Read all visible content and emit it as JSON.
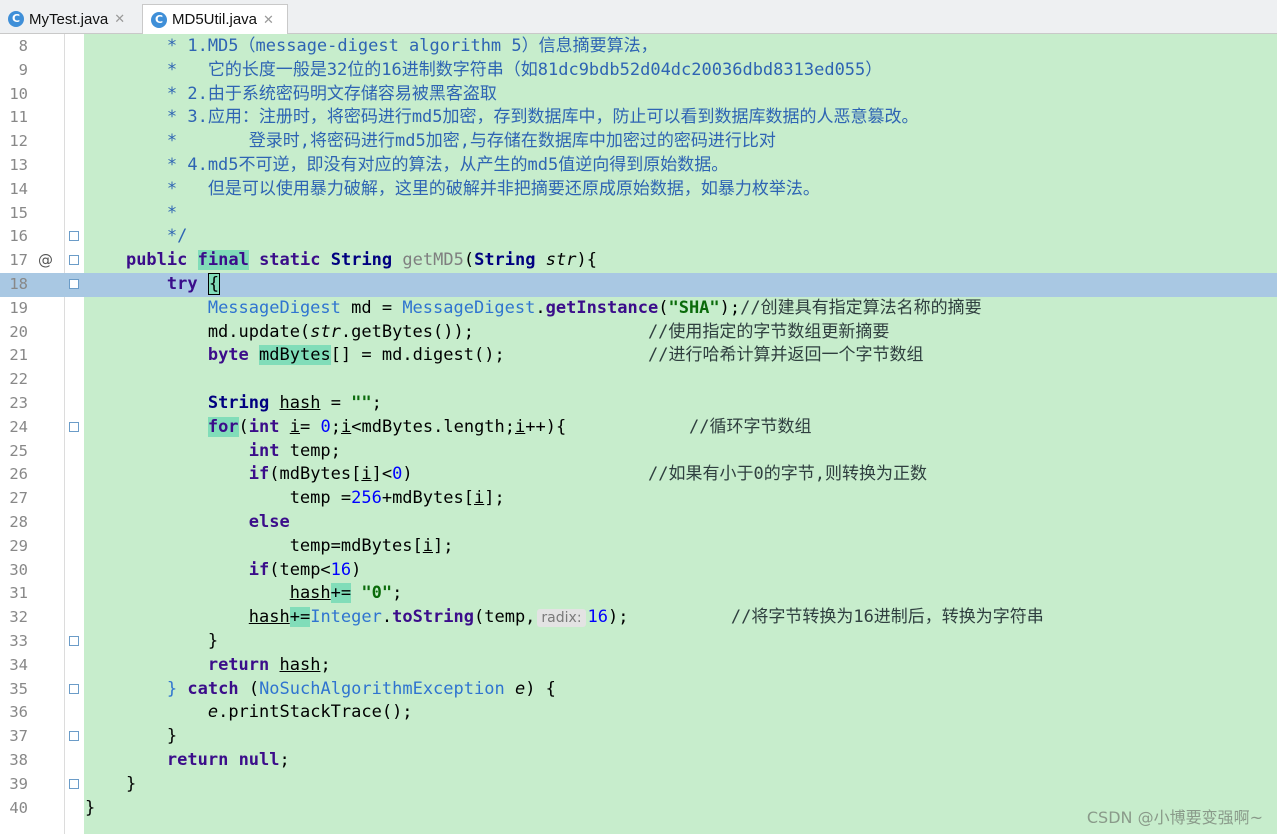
{
  "tabs": [
    {
      "label": "MyTest.java",
      "icon": "java-class-icon",
      "active": false
    },
    {
      "label": "MD5Util.java",
      "icon": "java-class-icon",
      "active": true
    }
  ],
  "current_line": 18,
  "lines": [
    {
      "n": "8",
      "segs": [
        [
          "        * 1.MD5（message-digest algorithm 5）信息摘要算法，",
          "cm"
        ]
      ]
    },
    {
      "n": "9",
      "segs": [
        [
          "        *   它的长度一般是32位的16进制数字符串（如81dc9bdb52d04dc20036dbd8313ed055）",
          "cm"
        ]
      ]
    },
    {
      "n": "10",
      "segs": [
        [
          "        * 2.由于系统密码明文存储容易被黑客盗取",
          "cm"
        ]
      ]
    },
    {
      "n": "11",
      "segs": [
        [
          "        * 3.应用：注册时，将密码进行md5加密，存到数据库中，防止可以看到数据库数据的人恶意篡改。",
          "cm"
        ]
      ]
    },
    {
      "n": "12",
      "segs": [
        [
          "        *       登录时,将密码进行md5加密,与存储在数据库中加密过的密码进行比对",
          "cm"
        ]
      ]
    },
    {
      "n": "13",
      "segs": [
        [
          "        * 4.md5不可逆，即没有对应的算法，从产生的md5值逆向得到原始数据。",
          "cm"
        ]
      ]
    },
    {
      "n": "14",
      "segs": [
        [
          "        *   但是可以使用暴力破解，这里的破解并非把摘要还原成原始数据，如暴力枚举法。",
          "cm"
        ]
      ]
    },
    {
      "n": "15",
      "segs": [
        [
          "        *",
          "cm"
        ]
      ]
    },
    {
      "n": "16",
      "fold": true,
      "segs": [
        [
          "        */",
          "cm"
        ]
      ]
    },
    {
      "n": "17",
      "mark": "@",
      "fold": true,
      "segs": [
        [
          "    ",
          ""
        ],
        [
          "public",
          "kw"
        ],
        [
          " ",
          ""
        ],
        [
          "final",
          "kw hl"
        ],
        [
          " ",
          ""
        ],
        [
          "static",
          "kw"
        ],
        [
          " ",
          ""
        ],
        [
          "String",
          "ty"
        ],
        [
          " ",
          ""
        ],
        [
          "getMD5",
          "gray"
        ],
        [
          "(",
          ""
        ],
        [
          "String",
          "ty"
        ],
        [
          " ",
          ""
        ],
        [
          "str",
          "it"
        ],
        [
          "){",
          ""
        ]
      ]
    },
    {
      "n": "18",
      "fold": true,
      "segs": [
        [
          "        ",
          ""
        ],
        [
          "try",
          "kw"
        ],
        [
          " ",
          ""
        ],
        [
          "{",
          "hl caret-box"
        ]
      ]
    },
    {
      "n": "19",
      "segs": [
        [
          "            ",
          ""
        ],
        [
          "MessageDigest",
          "cls"
        ],
        [
          " md = ",
          ""
        ],
        [
          "MessageDigest",
          "cls"
        ],
        [
          ".",
          ""
        ],
        [
          "getInstance",
          "kw"
        ],
        [
          "(",
          ""
        ],
        [
          "\"SHA\"",
          "str"
        ],
        [
          ");",
          ""
        ],
        [
          "//创建具有指定算法名称的摘要",
          "lc"
        ]
      ]
    },
    {
      "n": "20",
      "segs": [
        [
          "            md.update(",
          ""
        ],
        [
          "str",
          "it"
        ],
        [
          ".getBytes());                 ",
          ""
        ],
        [
          "//使用指定的字节数组更新摘要",
          "lc"
        ]
      ]
    },
    {
      "n": "21",
      "segs": [
        [
          "            ",
          ""
        ],
        [
          "byte",
          "kw"
        ],
        [
          " ",
          ""
        ],
        [
          "mdBytes",
          "hl"
        ],
        [
          "[] = md.digest();              ",
          ""
        ],
        [
          "//进行哈希计算并返回一个字节数组",
          "lc"
        ]
      ]
    },
    {
      "n": "22",
      "segs": [
        [
          "",
          ""
        ]
      ]
    },
    {
      "n": "23",
      "segs": [
        [
          "            ",
          ""
        ],
        [
          "String",
          "ty"
        ],
        [
          " ",
          ""
        ],
        [
          "hash",
          "ul"
        ],
        [
          " = ",
          ""
        ],
        [
          "\"\"",
          "str"
        ],
        [
          ";",
          ""
        ]
      ]
    },
    {
      "n": "24",
      "fold": true,
      "segs": [
        [
          "            ",
          ""
        ],
        [
          "for",
          "kw hl"
        ],
        [
          "(",
          ""
        ],
        [
          "int",
          "kw"
        ],
        [
          " ",
          ""
        ],
        [
          "i",
          "ul"
        ],
        [
          "= ",
          ""
        ],
        [
          "0",
          "num"
        ],
        [
          ";",
          ""
        ],
        [
          "i",
          "ul"
        ],
        [
          "<mdBytes.length;",
          ""
        ],
        [
          "i",
          "ul"
        ],
        [
          "++){            ",
          ""
        ],
        [
          "//循环字节数组",
          "lc"
        ]
      ]
    },
    {
      "n": "25",
      "segs": [
        [
          "                ",
          ""
        ],
        [
          "int",
          "kw"
        ],
        [
          " temp;",
          ""
        ]
      ]
    },
    {
      "n": "26",
      "segs": [
        [
          "                ",
          ""
        ],
        [
          "if",
          "kw"
        ],
        [
          "(mdBytes[",
          ""
        ],
        [
          "i",
          "ul"
        ],
        [
          "]<",
          ""
        ],
        [
          "0",
          "num"
        ],
        [
          ")                       ",
          ""
        ],
        [
          "//如果有小于0的字节,则转换为正数",
          "lc"
        ]
      ]
    },
    {
      "n": "27",
      "segs": [
        [
          "                    temp =",
          ""
        ],
        [
          "256",
          "num"
        ],
        [
          "+mdBytes[",
          ""
        ],
        [
          "i",
          "ul"
        ],
        [
          "];",
          ""
        ]
      ]
    },
    {
      "n": "28",
      "segs": [
        [
          "                ",
          ""
        ],
        [
          "else",
          "kw"
        ]
      ]
    },
    {
      "n": "29",
      "segs": [
        [
          "                    temp=mdBytes[",
          ""
        ],
        [
          "i",
          "ul"
        ],
        [
          "];",
          ""
        ]
      ]
    },
    {
      "n": "30",
      "segs": [
        [
          "                ",
          ""
        ],
        [
          "if",
          "kw"
        ],
        [
          "(temp<",
          ""
        ],
        [
          "16",
          "num"
        ],
        [
          ")",
          ""
        ]
      ]
    },
    {
      "n": "31",
      "segs": [
        [
          "                    ",
          ""
        ],
        [
          "hash",
          "ul"
        ],
        [
          "+=",
          "hl"
        ],
        [
          " ",
          ""
        ],
        [
          "\"0\"",
          "str"
        ],
        [
          ";",
          ""
        ]
      ]
    },
    {
      "n": "32",
      "segs": [
        [
          "                ",
          ""
        ],
        [
          "hash",
          "ul"
        ],
        [
          "+=",
          "hl"
        ],
        [
          "Integer",
          "cls"
        ],
        [
          ".",
          ""
        ],
        [
          "toString",
          "kw"
        ],
        [
          "(temp,",
          ""
        ],
        [
          "radix:",
          "hint"
        ],
        [
          "16",
          "num"
        ],
        [
          ");          ",
          ""
        ],
        [
          "//将字节转换为16进制后，转换为字符串",
          "lc"
        ]
      ]
    },
    {
      "n": "33",
      "fold": true,
      "segs": [
        [
          "            }",
          ""
        ]
      ]
    },
    {
      "n": "34",
      "segs": [
        [
          "            ",
          ""
        ],
        [
          "return",
          "kw"
        ],
        [
          " ",
          ""
        ],
        [
          "hash",
          "ul"
        ],
        [
          ";",
          ""
        ]
      ]
    },
    {
      "n": "35",
      "fold": true,
      "segs": [
        [
          "        ",
          ""
        ],
        [
          "}",
          "cls"
        ],
        [
          " ",
          ""
        ],
        [
          "catch",
          "kw"
        ],
        [
          " (",
          ""
        ],
        [
          "NoSuchAlgorithmException",
          "cls"
        ],
        [
          " ",
          ""
        ],
        [
          "e",
          "it"
        ],
        [
          ") {",
          ""
        ]
      ]
    },
    {
      "n": "36",
      "segs": [
        [
          "            ",
          ""
        ],
        [
          "e",
          "it"
        ],
        [
          ".printStackTrace();",
          ""
        ]
      ]
    },
    {
      "n": "37",
      "fold": true,
      "segs": [
        [
          "        }",
          ""
        ]
      ]
    },
    {
      "n": "38",
      "segs": [
        [
          "        ",
          ""
        ],
        [
          "return",
          "kw"
        ],
        [
          " ",
          ""
        ],
        [
          "null",
          "kw"
        ],
        [
          ";",
          ""
        ]
      ]
    },
    {
      "n": "39",
      "fold": true,
      "segs": [
        [
          "    }",
          ""
        ]
      ]
    },
    {
      "n": "40",
      "segs": [
        [
          "}",
          ""
        ]
      ]
    }
  ],
  "watermark": "CSDN @小博要变强啊~"
}
